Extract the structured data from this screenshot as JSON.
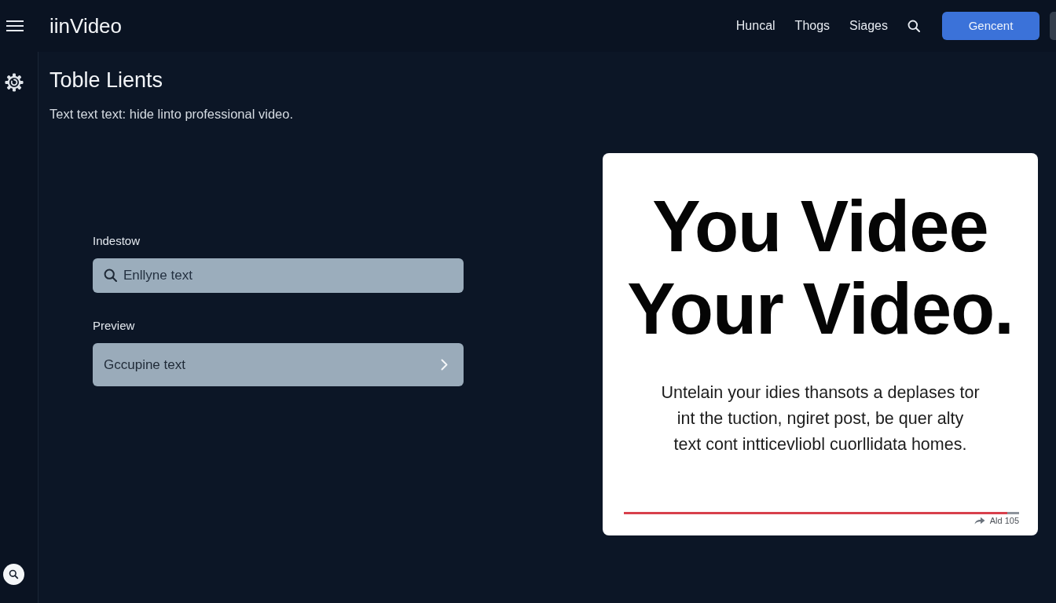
{
  "header": {
    "logo": "iinVideo",
    "nav": [
      "Huncal",
      "Thogs",
      "Siages"
    ],
    "primary_button": "Gencent"
  },
  "page": {
    "title": "Toble Lients",
    "subtitle": "Text text text: hide linto professional video."
  },
  "form": {
    "fields": [
      {
        "kind": "search",
        "label": "Indestow",
        "placeholder": "Enllyne text"
      },
      {
        "kind": "select",
        "label": "Preview",
        "value": "Gccupine text"
      }
    ]
  },
  "preview": {
    "headline_lines": [
      "You Videe",
      "Your Video."
    ],
    "body_lines": [
      "Untelain your idies thansots a deplases tor",
      "int the tuction, ngiret post, be quer alty",
      "text cont intticevliobl cuorllidata homes."
    ],
    "progress": {
      "level": 0.97
    },
    "caption": "Ald 105"
  }
}
